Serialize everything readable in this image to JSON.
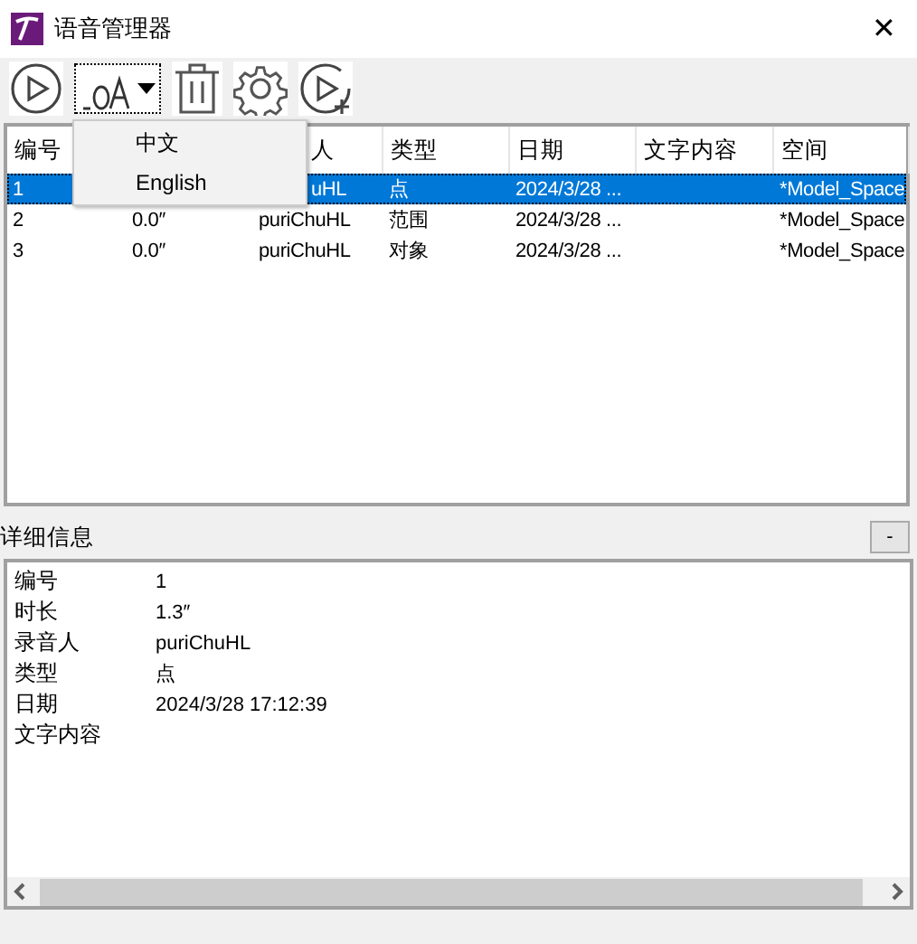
{
  "window": {
    "title": "语音管理器",
    "close": "✕"
  },
  "language_menu": {
    "items": [
      {
        "label": "中文"
      },
      {
        "label": "English"
      }
    ]
  },
  "table": {
    "columns": [
      {
        "label": "编号"
      },
      {},
      {
        "label": "人"
      },
      {
        "label": "类型"
      },
      {
        "label": "日期"
      },
      {
        "label": "文字内容"
      },
      {
        "label": "空间"
      }
    ],
    "rows": [
      {
        "selected": true,
        "cells": [
          "1",
          null,
          "uHL",
          "点",
          "2024/3/28 ...",
          null,
          "*Model_Space"
        ]
      },
      {
        "selected": false,
        "cells": [
          "2",
          "0.0″",
          "puriChuHL",
          "范围",
          "2024/3/28 ...",
          null,
          "*Model_Space"
        ]
      },
      {
        "selected": false,
        "cells": [
          "3",
          "0.0″",
          "puriChuHL",
          "对象",
          "2024/3/28 ...",
          null,
          "*Model_Space"
        ]
      }
    ]
  },
  "details": {
    "title": "详细信息",
    "collapse": "-",
    "fields": [
      {
        "label": "编号",
        "value": "1"
      },
      {
        "label": "时长",
        "value": "1.3″"
      },
      {
        "label": "录音人",
        "value": "puriChuHL"
      },
      {
        "label": "类型",
        "value": "点"
      },
      {
        "label": "日期",
        "value": "2024/3/28 17:12:39"
      },
      {
        "label": "文字内容"
      }
    ]
  }
}
